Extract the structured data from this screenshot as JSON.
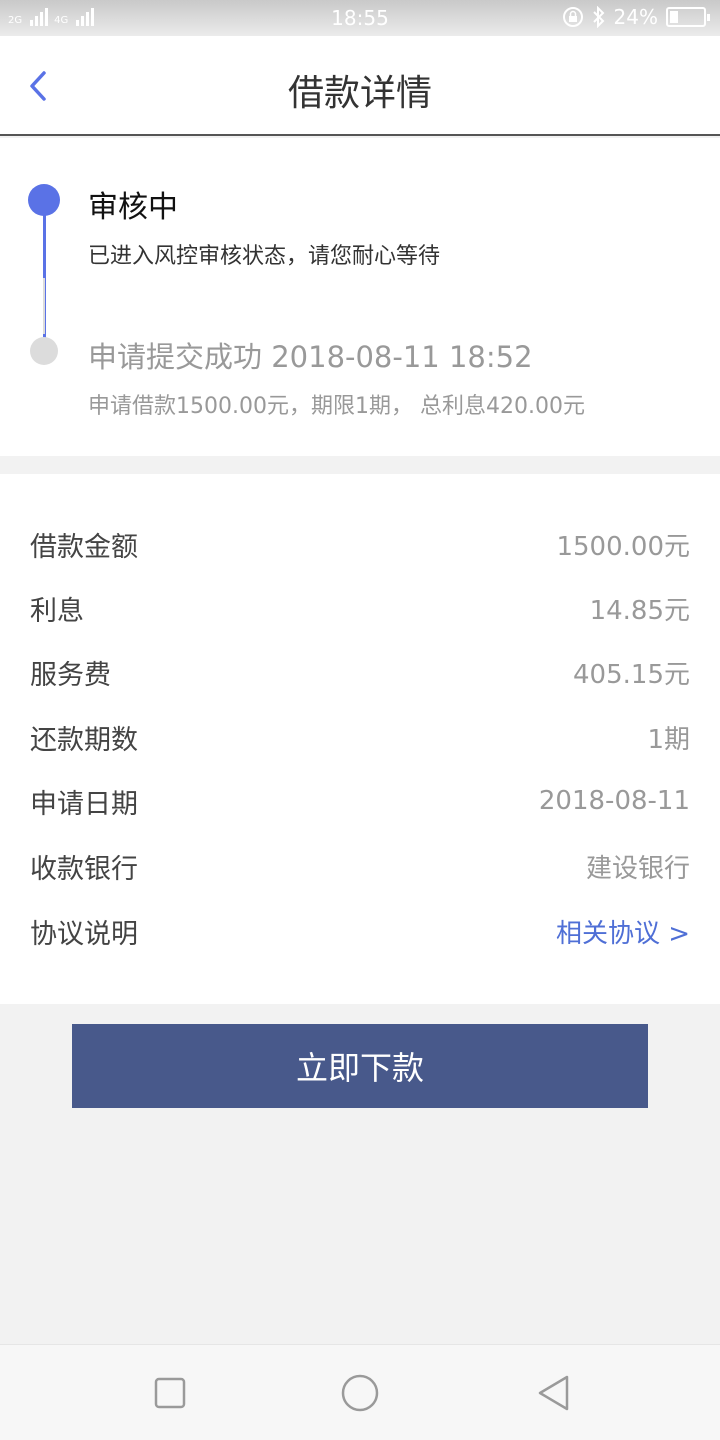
{
  "status_bar": {
    "network_1": "2G",
    "network_2": "4G",
    "time": "18:55",
    "battery_text": "24%",
    "battery_level": 0.24
  },
  "header": {
    "title": "借款详情"
  },
  "timeline": {
    "steps": [
      {
        "title": "审核中",
        "description": "已进入风控审核状态，请您耐心等待"
      },
      {
        "title": "申请提交成功 2018-08-11 18:52",
        "description": "申请借款1500.00元，期限1期， 总利息420.00元"
      }
    ]
  },
  "details": {
    "rows": [
      {
        "label": "借款金额",
        "value": "1500.00元"
      },
      {
        "label": "利息",
        "value": "14.85元"
      },
      {
        "label": "服务费",
        "value": "405.15元"
      },
      {
        "label": "还款期数",
        "value": "1期"
      },
      {
        "label": "申请日期",
        "value": "2018-08-11"
      },
      {
        "label": "收款银行",
        "value": "建设银行"
      },
      {
        "label": "协议说明",
        "value": "相关协议 >"
      }
    ]
  },
  "actions": {
    "primary_label": "立即下款"
  },
  "colors": {
    "accent": "#5a72e6",
    "button": "#48598b",
    "link": "#4f6fd6"
  }
}
